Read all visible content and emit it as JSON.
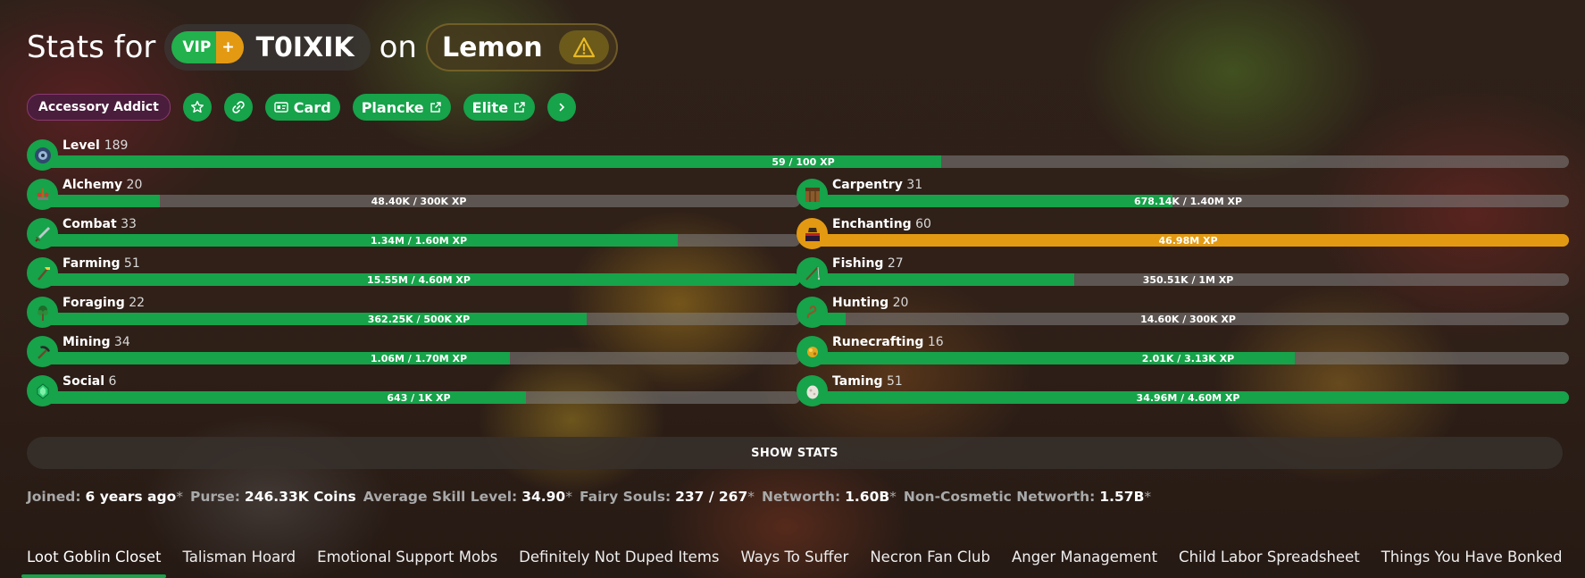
{
  "header": {
    "prefix": "Stats for",
    "vip": "VIP",
    "vip_plus": "+",
    "player": "T0IXIK",
    "on": "on",
    "profile": "Lemon"
  },
  "tags": {
    "badge": "Accessory Addict",
    "card": "Card",
    "plancke": "Plancke",
    "elite": "Elite"
  },
  "level": {
    "name": "Level",
    "level": "189",
    "xp": "59 / 100 XP",
    "progress": 0.59
  },
  "skills": [
    {
      "name": "Alchemy",
      "level": "20",
      "xp": "48.40K / 300K XP",
      "progress": 0.16,
      "icon": "brewing-stand-icon"
    },
    {
      "name": "Carpentry",
      "level": "31",
      "xp": "678.14K / 1.40M XP",
      "progress": 0.48,
      "icon": "crafting-table-icon"
    },
    {
      "name": "Combat",
      "level": "33",
      "xp": "1.34M / 1.60M XP",
      "progress": 0.84,
      "icon": "sword-icon"
    },
    {
      "name": "Enchanting",
      "level": "60",
      "xp": "46.98M XP",
      "progress": 1.0,
      "icon": "enchanting-table-icon",
      "maxed": true
    },
    {
      "name": "Farming",
      "level": "51",
      "xp": "15.55M / 4.60M XP",
      "progress": 1.0,
      "icon": "hoe-icon"
    },
    {
      "name": "Fishing",
      "level": "27",
      "xp": "350.51K / 1M XP",
      "progress": 0.35,
      "icon": "fishing-rod-icon"
    },
    {
      "name": "Foraging",
      "level": "22",
      "xp": "362.25K / 500K XP",
      "progress": 0.72,
      "icon": "sapling-icon"
    },
    {
      "name": "Hunting",
      "level": "20",
      "xp": "14.60K / 300K XP",
      "progress": 0.05,
      "icon": "lead-icon"
    },
    {
      "name": "Mining",
      "level": "34",
      "xp": "1.06M / 1.70M XP",
      "progress": 0.62,
      "icon": "pickaxe-icon"
    },
    {
      "name": "Runecrafting",
      "level": "16",
      "xp": "2.01K / 3.13K XP",
      "progress": 0.64,
      "icon": "magma-cream-icon"
    },
    {
      "name": "Social",
      "level": "6",
      "xp": "643 / 1K XP",
      "progress": 0.64,
      "icon": "emerald-icon"
    },
    {
      "name": "Taming",
      "level": "51",
      "xp": "34.96M / 4.60M XP",
      "progress": 1.0,
      "icon": "spawn-egg-icon"
    }
  ],
  "show_stats": "SHOW STATS",
  "stats": {
    "joined_label": "Joined:",
    "joined": "6 years ago",
    "purse_label": "Purse:",
    "purse": "246.33K Coins",
    "avg_label": "Average Skill Level:",
    "avg": "34.90",
    "souls_label": "Fairy Souls:",
    "souls": "237 / 267",
    "networth_label": "Networth:",
    "networth": "1.60B",
    "noncos_label": "Non-Cosmetic Networth:",
    "noncos": "1.57B",
    "star": "*"
  },
  "tabs": [
    "Loot Goblin Closet",
    "Talisman Hoard",
    "Emotional Support Mobs",
    "Definitely Not Duped Items",
    "Ways To Suffer",
    "Necron Fan Club",
    "Anger Management",
    "Child Labor Spreadsheet",
    "Things You Have Bonked"
  ],
  "colors": {
    "green": "#16a34a",
    "gold": "#e39a12",
    "purple": "#4a1d3c"
  }
}
